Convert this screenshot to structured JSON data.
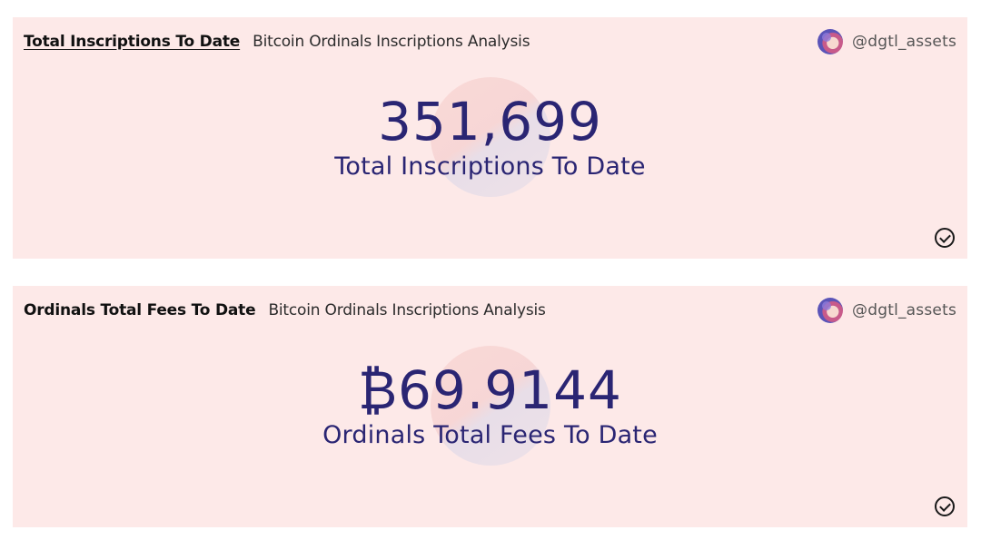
{
  "cards": [
    {
      "query_title": "Total Inscriptions To Date",
      "dashboard_name": "Bitcoin Ordinals Inscriptions Analysis",
      "author": "@dgtl_assets",
      "value": "351,699",
      "label": "Total Inscriptions To Date",
      "status_icon": "check-circle-icon"
    },
    {
      "query_title": "Ordinals Total Fees To Date",
      "dashboard_name": "Bitcoin Ordinals Inscriptions Analysis",
      "author": "@dgtl_assets",
      "value": "₿69.9144",
      "label": "Ordinals Total Fees To Date",
      "status_icon": "check-circle-icon"
    }
  ],
  "colors": {
    "card_background": "#fde9e8",
    "counter_text": "#2a2573"
  }
}
